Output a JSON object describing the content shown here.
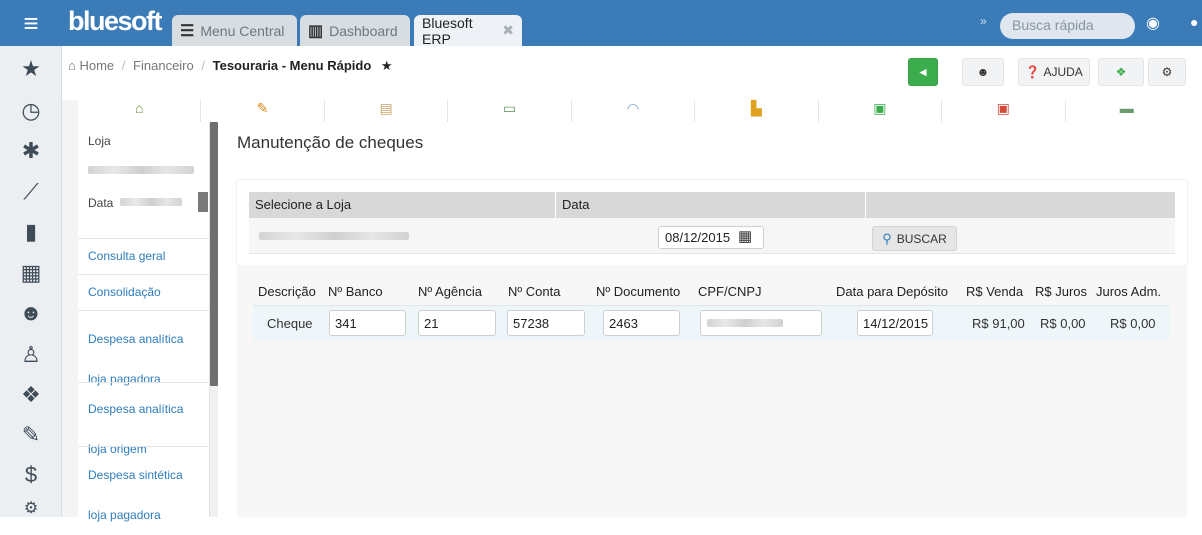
{
  "topbar": {
    "logo": "bluesoft",
    "tabs": [
      {
        "label": "Menu Central",
        "icon": "list-icon"
      },
      {
        "label": "Dashboard",
        "icon": "bar-chart-icon"
      },
      {
        "label": "Bluesoft ERP",
        "icon": "close-icon"
      }
    ],
    "search_placeholder": "Busca rápida"
  },
  "breadcrumb": {
    "home": "Home",
    "section": "Financeiro",
    "current": "Tesouraria - Menu Rápido"
  },
  "toolbar": {
    "help_label": "AJUDA"
  },
  "filters": {
    "loja_label": "Loja",
    "data_label": "Data"
  },
  "menu": [
    "Consulta geral",
    "Consolidação",
    "Despesa analítica loja pagadora",
    "Despesa analítica loja origem",
    "Despesa sintética loja pagadora"
  ],
  "main": {
    "title": "Manutenção de cheques",
    "select_loja_header": "Selecione a Loja",
    "data_header": "Data",
    "date_value": "08/12/2015",
    "search_button": "BUSCAR"
  },
  "table": {
    "columns": [
      "Descrição",
      "Nº Banco",
      "Nº Agência",
      "Nº Conta",
      "Nº Documento",
      "CPF/CNPJ",
      "Data para Depósito",
      "R$ Venda",
      "R$ Juros",
      "Juros Adm."
    ],
    "rows": [
      {
        "descricao": "Cheque",
        "banco": "341",
        "agencia": "21",
        "conta": "57238",
        "documento": "2463",
        "data_deposito": "14/12/2015",
        "venda": "R$ 91,00",
        "juros": "R$ 0,00",
        "juros_adm": "R$ 0,00"
      }
    ]
  },
  "colors": {
    "topbar": "#3a7bb8",
    "link": "#2e7dbd",
    "accent_green": "#3cad4d"
  }
}
